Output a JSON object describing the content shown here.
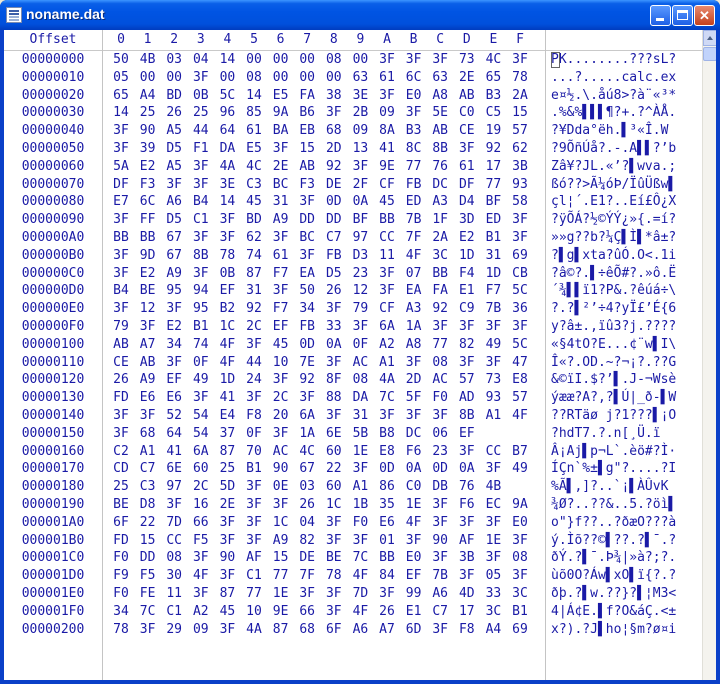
{
  "window": {
    "title": "noname.dat"
  },
  "header": {
    "offset_label": "Offset",
    "columns": [
      "0",
      "1",
      "2",
      "3",
      "4",
      "5",
      "6",
      "7",
      "8",
      "9",
      "A",
      "B",
      "C",
      "D",
      "E",
      "F"
    ]
  },
  "rows": [
    {
      "offset": "00000000",
      "bytes": [
        "50",
        "4B",
        "03",
        "04",
        "14",
        "00",
        "00",
        "00",
        "08",
        "00",
        "3F",
        "3F",
        "3F",
        "73",
        "4C",
        "3F"
      ],
      "ascii": "PK........???sL?"
    },
    {
      "offset": "00000010",
      "bytes": [
        "05",
        "00",
        "00",
        "3F",
        "00",
        "08",
        "00",
        "00",
        "00",
        "63",
        "61",
        "6C",
        "63",
        "2E",
        "65",
        "78"
      ],
      "ascii": "...?.....calc.ex"
    },
    {
      "offset": "00000020",
      "bytes": [
        "65",
        "A4",
        "BD",
        "0B",
        "5C",
        "14",
        "E5",
        "FA",
        "38",
        "3E",
        "3F",
        "E0",
        "A8",
        "AB",
        "B3",
        "2A"
      ],
      "ascii": "e¤½.\\.åú8>?à¨«³*"
    },
    {
      "offset": "00000030",
      "bytes": [
        "14",
        "25",
        "26",
        "25",
        "96",
        "85",
        "9A",
        "B6",
        "3F",
        "2B",
        "09",
        "3F",
        "5E",
        "C0",
        "C5",
        "15"
      ],
      "ascii": ".%&%▌▌▌¶?+.?^ÀÅ."
    },
    {
      "offset": "00000040",
      "bytes": [
        "3F",
        "90",
        "A5",
        "44",
        "64",
        "61",
        "BA",
        "EB",
        "68",
        "09",
        "8A",
        "B3",
        "AB",
        "CE",
        "19",
        "57"
      ],
      "ascii": "?¥Dda°ëh.▌³«Î.W"
    },
    {
      "offset": "00000050",
      "bytes": [
        "3F",
        "39",
        "D5",
        "F1",
        "DA",
        "E5",
        "3F",
        "15",
        "2D",
        "13",
        "41",
        "8C",
        "8B",
        "3F",
        "92",
        "62"
      ],
      "ascii": "?9ÕñÚå?.-.A▌▌?’b"
    },
    {
      "offset": "00000060",
      "bytes": [
        "5A",
        "E2",
        "A5",
        "3F",
        "4A",
        "4C",
        "2E",
        "AB",
        "92",
        "3F",
        "9E",
        "77",
        "76",
        "61",
        "17",
        "3B"
      ],
      "ascii": "Zâ¥?JL.«’?▌wva.;"
    },
    {
      "offset": "00000070",
      "bytes": [
        "DF",
        "F3",
        "3F",
        "3F",
        "3E",
        "C3",
        "BC",
        "F3",
        "DE",
        "2F",
        "CF",
        "FB",
        "DC",
        "DF",
        "77",
        "93"
      ],
      "ascii": "ßó??>Ã¼óÞ/ÏûÜßw▌"
    },
    {
      "offset": "00000080",
      "bytes": [
        "E7",
        "6C",
        "A6",
        "B4",
        "14",
        "45",
        "31",
        "3F",
        "0D",
        "0A",
        "45",
        "ED",
        "A3",
        "D4",
        "BF",
        "58"
      ],
      "ascii": "çl¦´.E1?..Eí£Ô¿X"
    },
    {
      "offset": "00000090",
      "bytes": [
        "3F",
        "FF",
        "D5",
        "C1",
        "3F",
        "BD",
        "A9",
        "DD",
        "DD",
        "BF",
        "BB",
        "7B",
        "1F",
        "3D",
        "ED",
        "3F"
      ],
      "ascii": "?ÿÕÁ?½©ÝÝ¿»{.=í?"
    },
    {
      "offset": "000000A0",
      "bytes": [
        "BB",
        "BB",
        "67",
        "3F",
        "3F",
        "62",
        "3F",
        "BC",
        "C7",
        "97",
        "CC",
        "7F",
        "2A",
        "E2",
        "B1",
        "3F"
      ],
      "ascii": "»»g??b?¼Ç▌Ì▌*â±?"
    },
    {
      "offset": "000000B0",
      "bytes": [
        "3F",
        "9D",
        "67",
        "8B",
        "78",
        "74",
        "61",
        "3F",
        "FB",
        "D3",
        "11",
        "4F",
        "3C",
        "1D",
        "31",
        "69"
      ],
      "ascii": "?▌g▌xta?ûÓ.O<.1i"
    },
    {
      "offset": "000000C0",
      "bytes": [
        "3F",
        "E2",
        "A9",
        "3F",
        "0B",
        "87",
        "F7",
        "EA",
        "D5",
        "23",
        "3F",
        "07",
        "BB",
        "F4",
        "1D",
        "CB"
      ],
      "ascii": "?â©?.▌÷êÕ#?.»ô.Ë"
    },
    {
      "offset": "000000D0",
      "bytes": [
        "B4",
        "BE",
        "95",
        "94",
        "EF",
        "31",
        "3F",
        "50",
        "26",
        "12",
        "3F",
        "EA",
        "FA",
        "E1",
        "F7",
        "5C"
      ],
      "ascii": "´¾▌▌ï1?P&.?êúá÷\\"
    },
    {
      "offset": "000000E0",
      "bytes": [
        "3F",
        "12",
        "3F",
        "95",
        "B2",
        "92",
        "F7",
        "34",
        "3F",
        "79",
        "CF",
        "A3",
        "92",
        "C9",
        "7B",
        "36"
      ],
      "ascii": "?.?▌²’÷4?yÏ£’É{6"
    },
    {
      "offset": "000000F0",
      "bytes": [
        "79",
        "3F",
        "E2",
        "B1",
        "1C",
        "2C",
        "EF",
        "FB",
        "33",
        "3F",
        "6A",
        "1A",
        "3F",
        "3F",
        "3F",
        "3F"
      ],
      "ascii": "y?â±.,ïû3?j.????"
    },
    {
      "offset": "00000100",
      "bytes": [
        "AB",
        "A7",
        "34",
        "74",
        "4F",
        "3F",
        "45",
        "0D",
        "0A",
        "0F",
        "A2",
        "A8",
        "77",
        "82",
        "49",
        "5C"
      ],
      "ascii": "«§4tO?E...¢¨w▌I\\"
    },
    {
      "offset": "00000110",
      "bytes": [
        "CE",
        "AB",
        "3F",
        "0F",
        "4F",
        "44",
        "10",
        "7E",
        "3F",
        "AC",
        "A1",
        "3F",
        "08",
        "3F",
        "3F",
        "47"
      ],
      "ascii": "Î«?.OD.~?¬¡?.??G"
    },
    {
      "offset": "00000120",
      "bytes": [
        "26",
        "A9",
        "EF",
        "49",
        "1D",
        "24",
        "3F",
        "92",
        "8F",
        "08",
        "4A",
        "2D",
        "AC",
        "57",
        "73",
        "E8"
      ],
      "ascii": "&©ïI.$?’▌.J-¬Wsè"
    },
    {
      "offset": "00000130",
      "bytes": [
        "FD",
        "E6",
        "E6",
        "3F",
        "41",
        "3F",
        "2C",
        "3F",
        "88",
        "DA",
        "7C",
        "5F",
        "F0",
        "AD",
        "93",
        "57"
      ],
      "ascii": "ýææ?A?,?▌Ú|_ð-▌W"
    },
    {
      "offset": "00000140",
      "bytes": [
        "3F",
        "3F",
        "52",
        "54",
        "E4",
        "F8",
        "20",
        "6A",
        "3F",
        "31",
        "3F",
        "3F",
        "3F",
        "8B",
        "A1",
        "4F"
      ],
      "ascii": "??RTäø j?1???▌¡O"
    },
    {
      "offset": "00000150",
      "bytes": [
        "3F",
        "68",
        "64",
        "54",
        "37",
        "0F",
        "3F",
        "1A",
        "6E",
        "5B",
        "B8",
        "DC",
        "06",
        "EF"
      ],
      "ascii": "?hdT7.?.n[¸Ü.ï"
    },
    {
      "offset": "00000160",
      "bytes": [
        "C2",
        "A1",
        "41",
        "6A",
        "87",
        "70",
        "AC",
        "4C",
        "60",
        "1E",
        "E8",
        "F6",
        "23",
        "3F",
        "CC",
        "B7"
      ],
      "ascii": "Â¡Aj▌p¬L`.èö#?Ì·"
    },
    {
      "offset": "00000170",
      "bytes": [
        "CD",
        "C7",
        "6E",
        "60",
        "25",
        "B1",
        "90",
        "67",
        "22",
        "3F",
        "0D",
        "0A",
        "0D",
        "0A",
        "3F",
        "49"
      ],
      "ascii": "ÍÇn`%±▌g\"?....?I"
    },
    {
      "offset": "00000180",
      "bytes": [
        "25",
        "C3",
        "97",
        "2C",
        "5D",
        "3F",
        "0E",
        "03",
        "60",
        "A1",
        "86",
        "C0",
        "DB",
        "76",
        "4B"
      ],
      "ascii": "%Ã▌,]?..`¡▌ÀÛvK"
    },
    {
      "offset": "00000190",
      "bytes": [
        "BE",
        "D8",
        "3F",
        "16",
        "2E",
        "3F",
        "3F",
        "26",
        "1C",
        "1B",
        "35",
        "1E",
        "3F",
        "F6",
        "EC",
        "9A"
      ],
      "ascii": "¾Ø?..??&..5.?öì▌"
    },
    {
      "offset": "000001A0",
      "bytes": [
        "6F",
        "22",
        "7D",
        "66",
        "3F",
        "3F",
        "1C",
        "04",
        "3F",
        "F0",
        "E6",
        "4F",
        "3F",
        "3F",
        "3F",
        "E0"
      ],
      "ascii": "o\"}f??..?ðæO???à"
    },
    {
      "offset": "000001B0",
      "bytes": [
        "FD",
        "15",
        "CC",
        "F5",
        "3F",
        "3F",
        "A9",
        "82",
        "3F",
        "3F",
        "01",
        "3F",
        "90",
        "AF",
        "1E",
        "3F"
      ],
      "ascii": "ý.Ìõ??©▌??.?▌¯.?"
    },
    {
      "offset": "000001C0",
      "bytes": [
        "F0",
        "DD",
        "08",
        "3F",
        "90",
        "AF",
        "15",
        "DE",
        "BE",
        "7C",
        "BB",
        "E0",
        "3F",
        "3B",
        "3F",
        "08"
      ],
      "ascii": "ðÝ.?▌¯.Þ¾|»à?;?."
    },
    {
      "offset": "000001D0",
      "bytes": [
        "F9",
        "F5",
        "30",
        "4F",
        "3F",
        "C1",
        "77",
        "7F",
        "78",
        "4F",
        "84",
        "EF",
        "7B",
        "3F",
        "05",
        "3F"
      ],
      "ascii": "ùõ0O?Áw▌xO▌ï{?.?"
    },
    {
      "offset": "000001E0",
      "bytes": [
        "F0",
        "FE",
        "11",
        "3F",
        "87",
        "77",
        "1E",
        "3F",
        "3F",
        "7D",
        "3F",
        "99",
        "A6",
        "4D",
        "33",
        "3C"
      ],
      "ascii": "ðþ.?▌w.??}?▌¦M3<"
    },
    {
      "offset": "000001F0",
      "bytes": [
        "34",
        "7C",
        "C1",
        "A2",
        "45",
        "10",
        "9E",
        "66",
        "3F",
        "4F",
        "26",
        "E1",
        "C7",
        "17",
        "3C",
        "B1"
      ],
      "ascii": "4|Á¢E.▌f?O&áÇ.<±"
    },
    {
      "offset": "00000200",
      "bytes": [
        "78",
        "3F",
        "29",
        "09",
        "3F",
        "4A",
        "87",
        "68",
        "6F",
        "A6",
        "A7",
        "6D",
        "3F",
        "F8",
        "A4",
        "69"
      ],
      "ascii": "x?).?J▌ho¦§m?ø¤i"
    }
  ]
}
